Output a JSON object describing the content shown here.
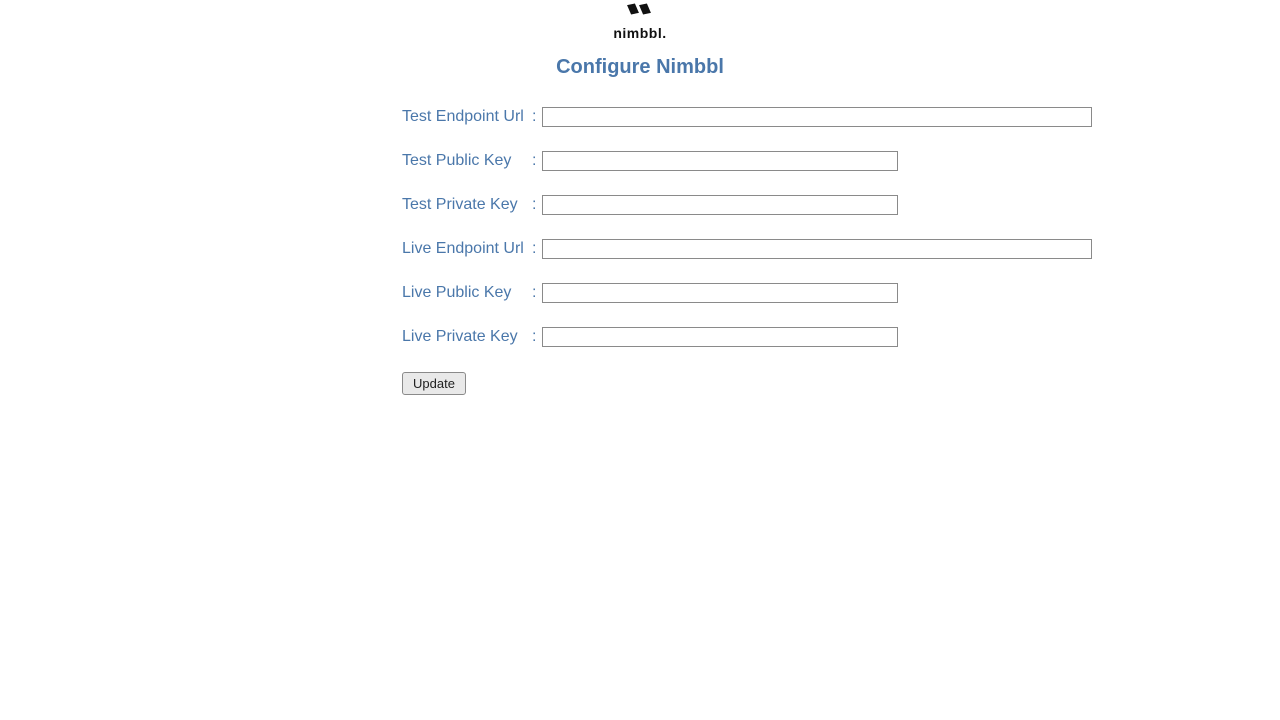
{
  "logo": {
    "text": "nimbbl."
  },
  "title": "Configure Nimbbl",
  "fields": {
    "test_endpoint_url": {
      "label": "Test Endpoint Url",
      "value": ""
    },
    "test_public_key": {
      "label": "Test Public Key",
      "value": ""
    },
    "test_private_key": {
      "label": "Test Private Key",
      "value": ""
    },
    "live_endpoint_url": {
      "label": "Live Endpoint Url",
      "value": ""
    },
    "live_public_key": {
      "label": "Live Public Key",
      "value": ""
    },
    "live_private_key": {
      "label": "Live Private Key",
      "value": ""
    }
  },
  "buttons": {
    "update": "Update"
  },
  "colors": {
    "accent": "#4a77aa"
  }
}
